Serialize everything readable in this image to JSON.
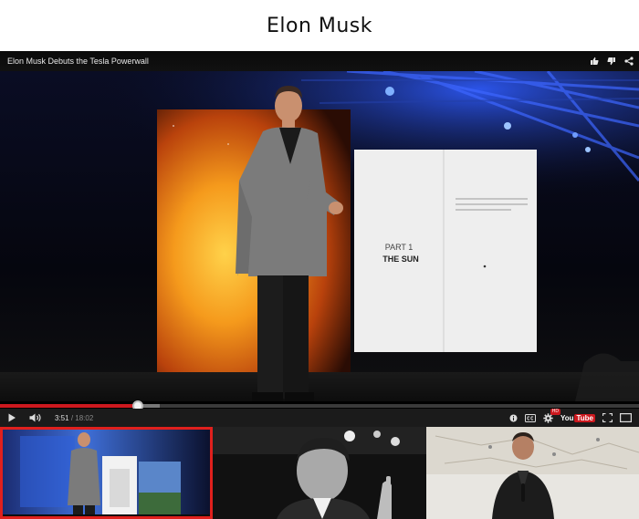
{
  "page": {
    "title": "Elon Musk"
  },
  "player": {
    "video_title": "Elon Musk Debuts the Tesla Powerwall",
    "slide": {
      "part_label": "PART 1",
      "part_title": "THE SUN"
    },
    "progress": {
      "played_fraction": 0.215,
      "buffered_fraction": 0.25
    },
    "time": {
      "current": "3:51",
      "separator": "/",
      "total": "18:02"
    },
    "hd_label": "HD",
    "logo": {
      "you": "You",
      "tube": "Tube"
    },
    "icons": {
      "like": "thumbs-up-icon",
      "dislike": "thumbs-down-icon",
      "share": "share-icon",
      "play": "play-icon",
      "volume": "volume-icon",
      "info": "info-icon",
      "captions": "captions-icon",
      "settings": "gear-icon",
      "fullscreen": "fullscreen-icon",
      "theater": "theater-mode-icon"
    }
  },
  "thumbnails": [
    {
      "selected": true
    },
    {
      "selected": false
    },
    {
      "selected": false
    }
  ],
  "colors": {
    "accent_red": "#cc181e",
    "selected_outline": "#e0201d"
  }
}
